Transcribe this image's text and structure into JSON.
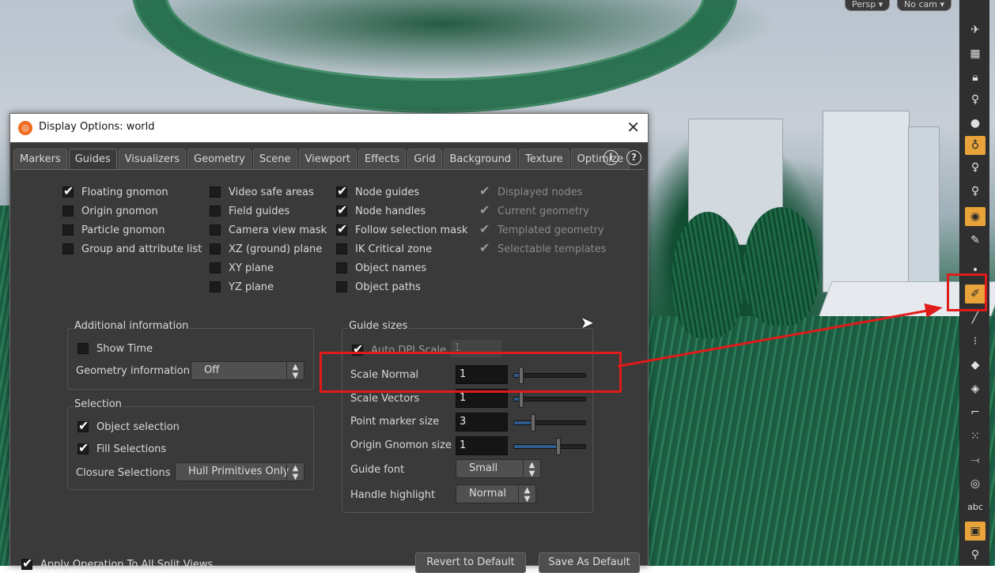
{
  "viewport": {
    "persp_label": "Persp ▾",
    "cam_label": "No cam ▾"
  },
  "dialog": {
    "title": "Display Options:  world",
    "tabs": [
      "Markers",
      "Guides",
      "Visualizers",
      "Geometry",
      "Scene",
      "Viewport",
      "Effects",
      "Grid",
      "Background",
      "Texture",
      "Optimize"
    ],
    "active_tab": "Guides",
    "info_icon": "ⓘ",
    "help_icon": "?",
    "col1": [
      {
        "label": "Floating gnomon",
        "checked": true
      },
      {
        "label": "Origin gnomon",
        "checked": false
      },
      {
        "label": "Particle gnomon",
        "checked": false
      },
      {
        "label": "Group and attribute list",
        "checked": false
      }
    ],
    "col2": [
      {
        "label": "Video safe areas",
        "checked": false
      },
      {
        "label": "Field guides",
        "checked": false
      },
      {
        "label": "Camera view mask",
        "checked": false
      },
      {
        "label": "XZ (ground) plane",
        "checked": false
      },
      {
        "label": "XY plane",
        "checked": false
      },
      {
        "label": "YZ plane",
        "checked": false
      }
    ],
    "col3": [
      {
        "label": "Node guides",
        "checked": true
      },
      {
        "label": "Node handles",
        "checked": true
      },
      {
        "label": "Follow selection mask",
        "checked": true
      },
      {
        "label": "IK Critical zone",
        "checked": false
      },
      {
        "label": "Object names",
        "checked": false
      },
      {
        "label": "Object paths",
        "checked": false
      }
    ],
    "col4": [
      {
        "label": "Displayed nodes",
        "checked": true
      },
      {
        "label": "Current geometry",
        "checked": true
      },
      {
        "label": "Templated geometry",
        "checked": true
      },
      {
        "label": "Selectable templates",
        "checked": true
      }
    ],
    "additional": {
      "title": "Additional information",
      "show_time": "Show Time",
      "geometry_info_label": "Geometry information",
      "geometry_info_value": "Off"
    },
    "selection": {
      "title": "Selection",
      "object_selection": "Object selection",
      "fill_selections": "Fill Selections",
      "closure_label": "Closure Selections",
      "closure_value": "Hull Primitives Only"
    },
    "guide_sizes": {
      "title": "Guide sizes",
      "auto_dpi": "Auto DPI Scale",
      "auto_dpi_value": "1",
      "rows": [
        {
          "label": "Scale Normal",
          "value": "1",
          "level": 0.1
        },
        {
          "label": "Scale Vectors",
          "value": "1",
          "level": 0.1
        },
        {
          "label": "Point marker size",
          "value": "3",
          "level": 0.27
        },
        {
          "label": "Origin Gnomon size",
          "value": "1",
          "level": 0.62
        }
      ],
      "guide_font_label": "Guide font",
      "guide_font_value": "Small",
      "handle_highlight_label": "Handle highlight",
      "handle_highlight_value": "Normal"
    },
    "footer": {
      "apply_split": "Apply Operation To All Split Views",
      "revert": "Revert to Default",
      "save": "Save As Default"
    }
  },
  "toolbar": {
    "abc_label": "abc"
  },
  "colors": {
    "annotation": "#e01b1b",
    "highlight": "#e8a33a"
  }
}
